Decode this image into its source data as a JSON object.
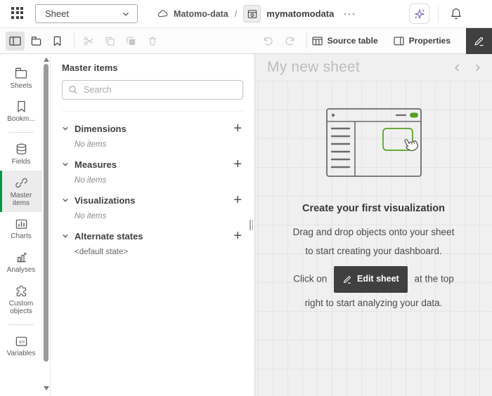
{
  "colors": {
    "accent-green": "#009845",
    "illustration-green": "#54a021",
    "dark-button": "#404040",
    "ai-purple": "#7b68c8"
  },
  "topbar": {
    "sheet_selector": "Sheet",
    "space_name": "Matomo-data",
    "breadcrumb_separator": "/",
    "app_name": "mymatomodata",
    "more_label": "···"
  },
  "toolbar": {
    "source_table_label": "Source table",
    "properties_label": "Properties"
  },
  "sidebar": {
    "items": [
      {
        "label": "Sheets"
      },
      {
        "label": "Bookm..."
      },
      {
        "label": "Fields"
      },
      {
        "label": "Master items"
      },
      {
        "label": "Charts"
      },
      {
        "label": "Analyses"
      },
      {
        "label": "Custom objects"
      },
      {
        "label": "Variables"
      }
    ]
  },
  "panel": {
    "title": "Master items",
    "search_placeholder": "Search",
    "sections": [
      {
        "label": "Dimensions",
        "empty_text": "No items"
      },
      {
        "label": "Measures",
        "empty_text": "No items"
      },
      {
        "label": "Visualizations",
        "empty_text": "No items"
      },
      {
        "label": "Alternate states",
        "empty_text": "<default state>"
      }
    ]
  },
  "sheet": {
    "title": "My new sheet",
    "empty_state": {
      "heading": "Create your first visualization",
      "description": "Drag and drop objects onto your sheet to start creating your dashboard.",
      "instruction_prefix": "Click on",
      "edit_button_label": "Edit sheet",
      "instruction_suffix": "at the top right to start analyzing your data."
    }
  }
}
